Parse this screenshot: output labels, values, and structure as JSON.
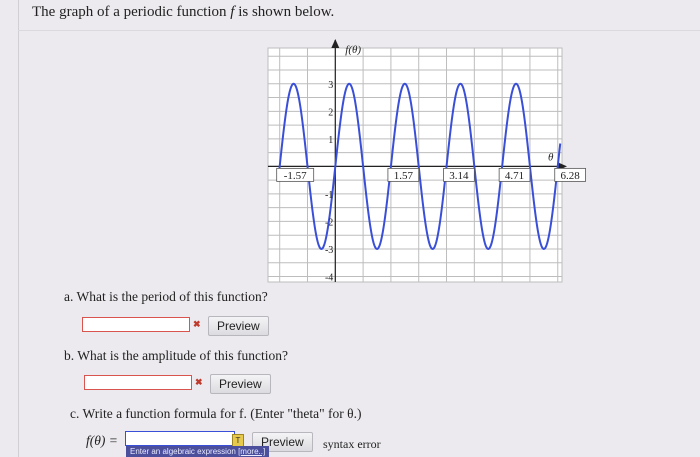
{
  "prompt": {
    "before": "The graph of a periodic function ",
    "var": "f",
    "after": " is shown below."
  },
  "chart_data": {
    "type": "line",
    "function": "3 sin(4θ)",
    "y_axis_label": "f(θ)",
    "x_axis_label": "θ",
    "x_tick_labels": [
      "-1.57",
      "1.57",
      "3.14",
      "4.71",
      "6.28"
    ],
    "x_tick_values": [
      -1.57,
      1.57,
      3.14,
      4.71,
      6.28
    ],
    "y_tick_labels": [
      "3",
      "2",
      "1",
      "-1",
      "-2",
      "-3",
      "-4"
    ],
    "y_tick_values": [
      3,
      2,
      1,
      -1,
      -2,
      -3,
      -4
    ],
    "xlim": [
      -1.9,
      6.4
    ],
    "ylim": [
      -4.2,
      4.3
    ],
    "amplitude": 3,
    "period": 1.57,
    "grid": true,
    "series_color": "#3a4fd8"
  },
  "questions": {
    "a": {
      "label": "a. What is the period of this function?",
      "value": ""
    },
    "b": {
      "label": "b. What is the amplitude of this function?",
      "value": ""
    },
    "c": {
      "label": "c. Write a function formula for f. (Enter \"theta\" for θ.)",
      "lhs": "f(θ) =",
      "value": ""
    }
  },
  "preview_label": "Preview",
  "error_badge": "✖",
  "tooltip": {
    "text": "Enter an algebraic expression",
    "more": "[more..]"
  },
  "syntax_error": "syntax error",
  "colors": {
    "accent": "#3a4fd8",
    "error": "#d9534f"
  }
}
